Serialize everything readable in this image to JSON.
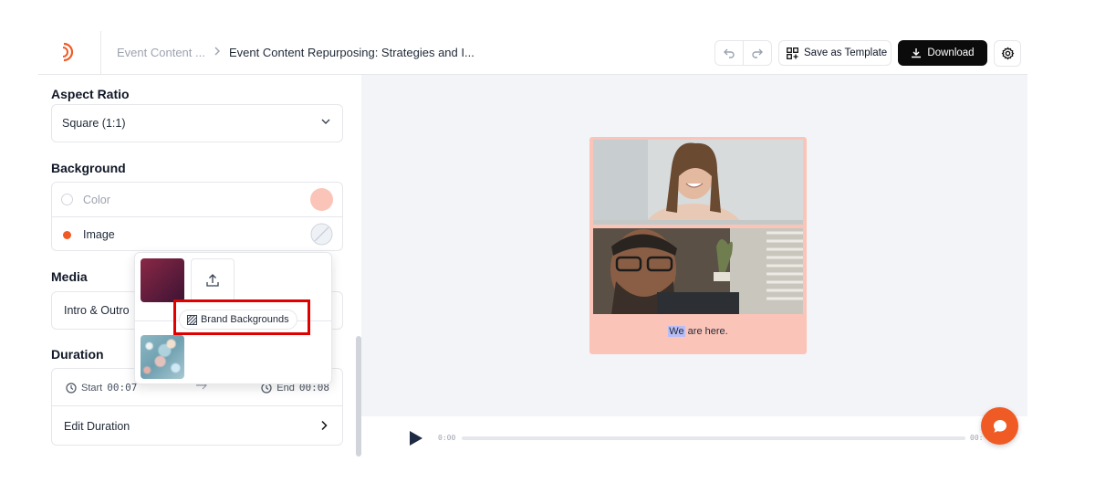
{
  "header": {
    "breadcrumb_parent": "Event Content ...",
    "breadcrumb_separator": ">",
    "breadcrumb_current": "Event Content Repurposing: Strategies and I...",
    "save_template_label": "Save as Template",
    "download_label": "Download"
  },
  "left_panel": {
    "aspect_ratio": {
      "title": "Aspect Ratio",
      "value": "Square (1:1)"
    },
    "background": {
      "title": "Background",
      "options": [
        {
          "label": "Color",
          "selected": false,
          "swatch_color": "#fbc4b8"
        },
        {
          "label": "Image",
          "selected": true
        }
      ]
    },
    "media": {
      "title": "Media",
      "value": "Intro & Outro"
    },
    "duration": {
      "title": "Duration",
      "start_label": "Start",
      "start_value": "00:07",
      "end_label": "End",
      "end_value": "00:08",
      "edit_label": "Edit Duration"
    }
  },
  "popup": {
    "brand_backgrounds_label": "Brand Backgrounds"
  },
  "preview": {
    "caption_highlight": "We",
    "caption_rest": " are here.",
    "card_color": "#fbc4b8"
  },
  "player": {
    "current_time": "0:00",
    "end_time": "00:"
  },
  "colors": {
    "accent": "#f05a24",
    "highlight_box": "#e00000"
  }
}
